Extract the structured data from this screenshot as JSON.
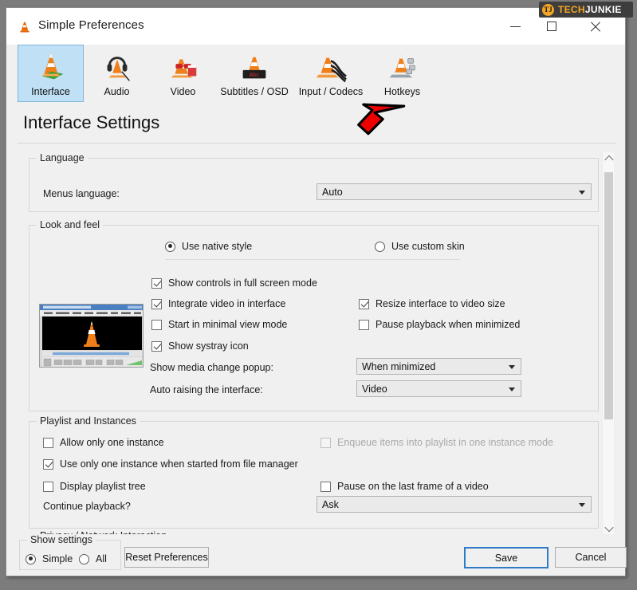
{
  "watermark": {
    "part1": "TECH",
    "part2": "JUNKIE",
    "logo": "TJ"
  },
  "window": {
    "title": "Simple Preferences",
    "app_icon": "vlc-cone-icon",
    "minimize": "minimize-icon",
    "maximize": "maximize-icon",
    "close": "close-icon"
  },
  "toolbar": {
    "items": [
      {
        "label": "Interface",
        "icon": "vlc-cone-interface-icon",
        "selected": true
      },
      {
        "label": "Audio",
        "icon": "vlc-cone-headphones-icon",
        "selected": false
      },
      {
        "label": "Video",
        "icon": "vlc-cone-glasses-icon",
        "selected": false
      },
      {
        "label": "Subtitles / OSD",
        "icon": "vlc-cone-subtitles-icon",
        "selected": false
      },
      {
        "label": "Input / Codecs",
        "icon": "vlc-cone-cables-icon",
        "selected": false
      },
      {
        "label": "Hotkeys",
        "icon": "vlc-cone-keys-icon",
        "selected": false
      }
    ]
  },
  "page": {
    "title": "Interface Settings"
  },
  "language_group": {
    "legend": "Language",
    "menus_language_label": "Menus language:",
    "menus_language_value": "Auto"
  },
  "look_and_feel": {
    "legend": "Look and feel",
    "style_radios": [
      {
        "label": "Use native style",
        "checked": true
      },
      {
        "label": "Use custom skin",
        "checked": false
      }
    ],
    "checkboxes": [
      {
        "label": "Show controls in full screen mode",
        "checked": true,
        "disabled": false
      },
      {
        "label": "Integrate video in interface",
        "checked": true,
        "disabled": false
      },
      {
        "label": "Resize interface to video size",
        "checked": true,
        "disabled": false
      },
      {
        "label": "Start in minimal view mode",
        "checked": false,
        "disabled": false
      },
      {
        "label": "Pause playback when minimized",
        "checked": false,
        "disabled": false
      },
      {
        "label": "Show systray icon",
        "checked": true,
        "disabled": false
      }
    ],
    "media_popup_label": "Show media change popup:",
    "media_popup_value": "When minimized",
    "auto_raise_label": "Auto raising the interface:",
    "auto_raise_value": "Video",
    "preview_alt": "vlc-player-preview-thumbnail"
  },
  "playlist_group": {
    "legend": "Playlist and Instances",
    "checkboxes": [
      {
        "label": "Allow only one instance",
        "checked": false,
        "disabled": false
      },
      {
        "label": "Enqueue items into playlist in one instance mode",
        "checked": false,
        "disabled": true
      },
      {
        "label": "Use only one instance when started from file manager",
        "checked": true,
        "disabled": false
      },
      {
        "label": "Display playlist tree",
        "checked": false,
        "disabled": false
      },
      {
        "label": "Pause on the last frame of a video",
        "checked": false,
        "disabled": false
      }
    ],
    "continue_label": "Continue playback?",
    "continue_value": "Ask"
  },
  "privacy_group": {
    "legend": "Privacy / Network Interaction"
  },
  "bottom": {
    "show_settings_legend": "Show settings",
    "simple_label": "Simple",
    "all_label": "All",
    "simple_checked": true,
    "all_checked": false,
    "reset_label": "Reset Preferences",
    "save_label": "Save",
    "cancel_label": "Cancel"
  },
  "annotation": {
    "arrow": "red-arrow-pointing-up-right",
    "color": "#ee0000"
  },
  "scrollbar": {
    "up": "scroll-up-icon",
    "down": "scroll-down-icon"
  }
}
